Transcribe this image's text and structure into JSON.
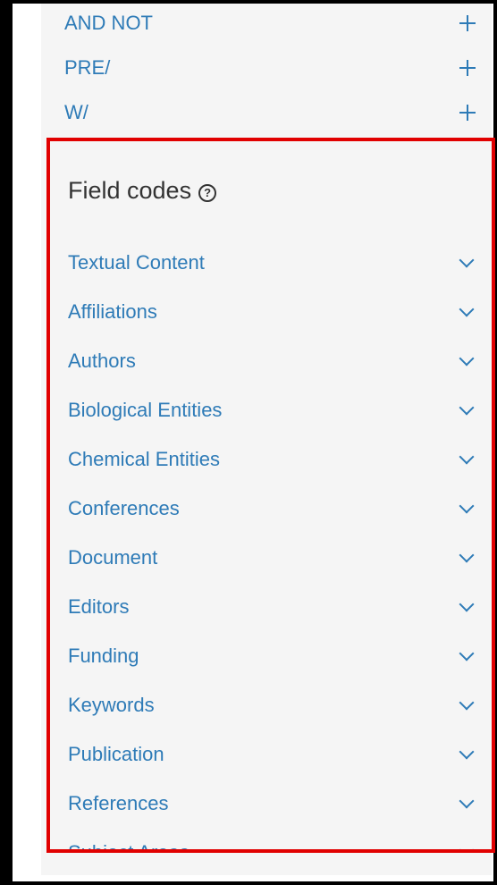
{
  "operators": [
    {
      "label": "AND NOT",
      "icon": "plus-icon"
    },
    {
      "label": "PRE/",
      "icon": "plus-icon"
    },
    {
      "label": "W/",
      "icon": "plus-icon"
    }
  ],
  "field_codes": {
    "title": "Field codes",
    "help_icon": "question-circle-icon",
    "help_glyph": "?",
    "items": [
      {
        "label": "Textual Content",
        "icon": "chevron-down-icon"
      },
      {
        "label": "Affiliations",
        "icon": "chevron-down-icon"
      },
      {
        "label": "Authors",
        "icon": "chevron-down-icon"
      },
      {
        "label": "Biological Entities",
        "icon": "chevron-down-icon"
      },
      {
        "label": "Chemical Entities",
        "icon": "chevron-down-icon"
      },
      {
        "label": "Conferences",
        "icon": "chevron-down-icon"
      },
      {
        "label": "Document",
        "icon": "chevron-down-icon"
      },
      {
        "label": "Editors",
        "icon": "chevron-down-icon"
      },
      {
        "label": "Funding",
        "icon": "chevron-down-icon"
      },
      {
        "label": "Keywords",
        "icon": "chevron-down-icon"
      },
      {
        "label": "Publication",
        "icon": "chevron-down-icon"
      },
      {
        "label": "References",
        "icon": "chevron-down-icon"
      },
      {
        "label": "Subject Areas",
        "icon": "chevron-down-icon"
      }
    ]
  },
  "colors": {
    "link": "#2e7bb7",
    "panel_bg": "#f5f5f5",
    "highlight_border": "#e10000",
    "frame": "#000000"
  }
}
